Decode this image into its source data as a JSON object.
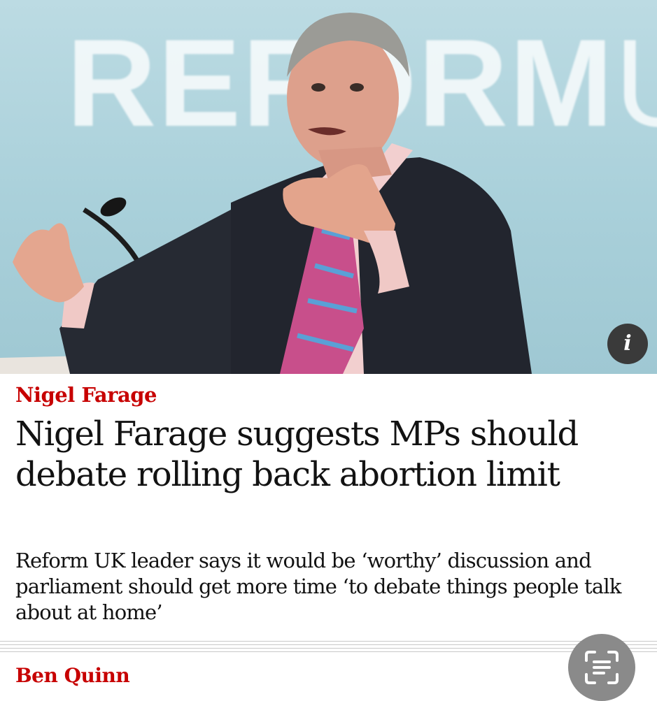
{
  "hero": {
    "background_text_left": "REFORM",
    "background_text_right": "UK",
    "info_button_label": "i"
  },
  "article": {
    "kicker": "Nigel Farage",
    "headline": "Nigel Farage suggests MPs should debate rolling back abortion limit",
    "standfirst": "Reform UK leader says it would be ‘worthy’ discussion and parliament should get more time ‘to debate things people talk about at home’",
    "byline": "Ben Quinn"
  },
  "colors": {
    "kicker": "#c70000",
    "text": "#121212",
    "backdrop": "#a9d0da"
  },
  "icons": {
    "info": "info-icon",
    "scan": "live-text-scan-icon"
  }
}
